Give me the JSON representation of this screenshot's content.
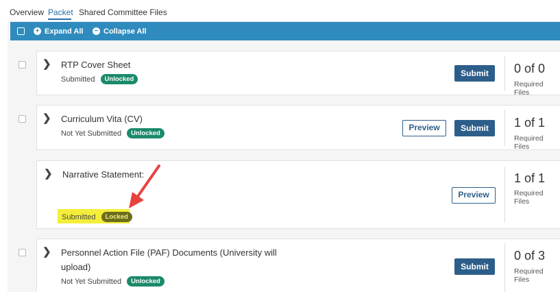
{
  "tabs": [
    {
      "label": "Overview",
      "active": false
    },
    {
      "label": "Packet",
      "active": true
    },
    {
      "label": "Shared Committee Files",
      "active": false
    }
  ],
  "toolbar": {
    "expand_label": "Expand All",
    "collapse_label": "Collapse All"
  },
  "items": [
    {
      "title": "RTP Cover Sheet",
      "status": "Submitted",
      "lock": "Unlocked",
      "submit_label": "Submit",
      "count": "0 of 0",
      "count_label": "Required Files"
    },
    {
      "title": "Curriculum Vita (CV)",
      "status": "Not Yet Submitted",
      "lock": "Unlocked",
      "preview_label": "Preview",
      "submit_label": "Submit",
      "count": "1 of 1",
      "count_label": "Required Files"
    },
    {
      "title": "Narrative Statement:",
      "status": "Submitted",
      "lock": "Locked",
      "preview_label": "Preview",
      "count": "1 of 1",
      "count_label": "Required Files"
    },
    {
      "title_line1": "Personnel Action File (PAF) Documents (University will",
      "title_line2": "upload)",
      "status": "Not Yet Submitted",
      "lock": "Unlocked",
      "submit_label": "Submit",
      "count": "0 of 3",
      "count_label": "Required Files"
    }
  ],
  "colors": {
    "toolbar_bg": "#2f8bbd",
    "submit_bg": "#2d5e8a",
    "unlocked_pill": "#1b8a6b",
    "locked_pill": "#6c6c1a",
    "highlight": "#f4ee3a",
    "arrow": "#e8423f"
  }
}
